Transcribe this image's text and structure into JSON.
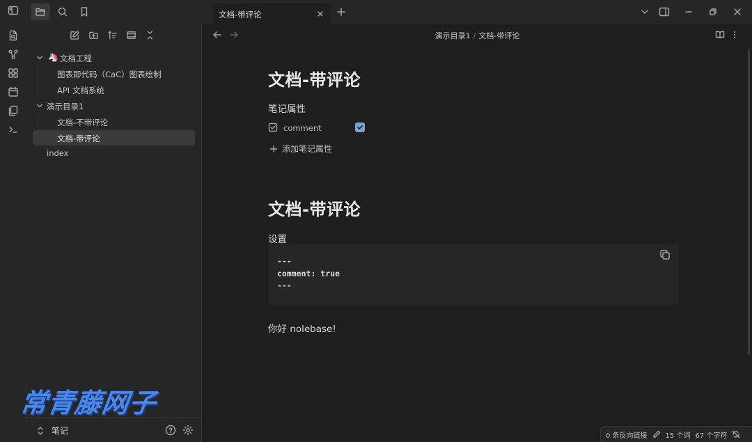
{
  "titlebar": {
    "icons": [
      "sidebar-toggle-icon",
      "folder-icon",
      "search-icon",
      "bookmark-icon"
    ]
  },
  "ribbon": {
    "icons": [
      "open-quick-switcher-icon",
      "graph-view-icon",
      "canvas-icon",
      "daily-note-icon",
      "templates-icon",
      "terminal-icon"
    ]
  },
  "file_explorer": {
    "actions": [
      "new-note-icon",
      "new-folder-icon",
      "sort-icon",
      "auto-reveal-icon",
      "collapse-all-icon"
    ],
    "tree": [
      {
        "label": "文档工程",
        "level": 0,
        "expanded": true,
        "has_emoji": true
      },
      {
        "label": "图表即代码（CaC）图表绘制",
        "level": 1
      },
      {
        "label": "API 文档系统",
        "level": 1
      },
      {
        "label": "演示目录1",
        "level": 0,
        "expanded": true
      },
      {
        "label": "文档-不带评论",
        "level": 1
      },
      {
        "label": "文档-带评论",
        "level": 1,
        "selected": true
      },
      {
        "label": "index",
        "level": 0
      }
    ]
  },
  "sidebar_footer": {
    "vault_name": "笔记"
  },
  "watermark": "常青藤网子",
  "tabs": {
    "active_title": "文档-带评论",
    "new_tab": "+"
  },
  "navbar": {
    "breadcrumb": [
      "演示目录1",
      "文档-带评论"
    ],
    "separator": "/"
  },
  "note": {
    "inline_title": "文档-带评论",
    "properties_heading": "笔记属性",
    "property": {
      "key": "comment",
      "checked": true
    },
    "add_property_label": "添加笔记属性",
    "h1": "文档-带评论",
    "settings_heading": "设置",
    "code_lines": [
      "---",
      "comment: true",
      "---"
    ],
    "body": "你好 nolebase!"
  },
  "statusbar": {
    "backlinks": "0 条反向链接",
    "words": "15 个词",
    "chars": "67 个字符"
  },
  "colors": {
    "accent": "#7c9fd6",
    "background": "#1e1e1e",
    "sidebar": "#262626",
    "watermark": "#4c86e8"
  }
}
